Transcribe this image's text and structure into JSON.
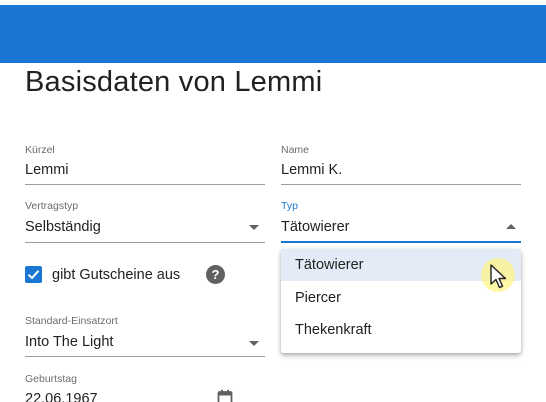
{
  "page": {
    "title": "Basisdaten von Lemmi"
  },
  "colors": {
    "primary": "#1976d2",
    "app_bar": "#1976d2",
    "selected_option_bg": "#e3ebf6"
  },
  "fields": {
    "kuerzel": {
      "label": "Kürzel",
      "value": "Lemmi"
    },
    "name": {
      "label": "Name",
      "value": "Lemmi K."
    },
    "vertragstyp": {
      "label": "Vertragstyp",
      "value": "Selbständig"
    },
    "typ": {
      "label": "Typ",
      "value": "Tätowierer",
      "options": [
        "Tätowierer",
        "Piercer",
        "Thekenkraft"
      ],
      "selected_index": 0
    },
    "gutscheine": {
      "label": "gibt Gutscheine aus",
      "checked": true,
      "help_icon": "help-circle-icon"
    },
    "einsatzort": {
      "label": "Standard-Einsatzort",
      "value": "Into The Light"
    },
    "geburtstag": {
      "label": "Geburtstag",
      "value": "22.06.1967",
      "icon": "calendar-icon"
    }
  }
}
